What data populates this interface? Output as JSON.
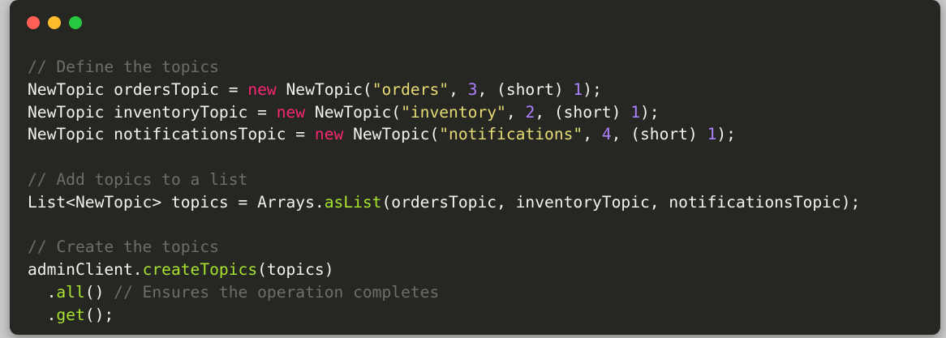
{
  "window": {
    "controls": [
      {
        "name": "close",
        "color": "#ff5f57"
      },
      {
        "name": "minimize",
        "color": "#febc2e"
      },
      {
        "name": "zoom",
        "color": "#28c840"
      }
    ]
  },
  "colors": {
    "background": "#262723",
    "text": "#f2f2ef",
    "comment": "#6e6e68",
    "keyword": "#f92672",
    "string": "#e6db74",
    "number": "#ae81ff",
    "function": "#a6e22e"
  },
  "code": {
    "lines": [
      [
        {
          "t": "cm",
          "v": "// Define the topics"
        }
      ],
      [
        {
          "t": "pl",
          "v": "NewTopic ordersTopic = "
        },
        {
          "t": "kw",
          "v": "new"
        },
        {
          "t": "pl",
          "v": " NewTopic("
        },
        {
          "t": "st",
          "v": "\"orders\""
        },
        {
          "t": "pl",
          "v": ", "
        },
        {
          "t": "nm",
          "v": "3"
        },
        {
          "t": "pl",
          "v": ", (short) "
        },
        {
          "t": "nm",
          "v": "1"
        },
        {
          "t": "pl",
          "v": ");"
        }
      ],
      [
        {
          "t": "pl",
          "v": "NewTopic inventoryTopic = "
        },
        {
          "t": "kw",
          "v": "new"
        },
        {
          "t": "pl",
          "v": " NewTopic("
        },
        {
          "t": "st",
          "v": "\"inventory\""
        },
        {
          "t": "pl",
          "v": ", "
        },
        {
          "t": "nm",
          "v": "2"
        },
        {
          "t": "pl",
          "v": ", (short) "
        },
        {
          "t": "nm",
          "v": "1"
        },
        {
          "t": "pl",
          "v": ");"
        }
      ],
      [
        {
          "t": "pl",
          "v": "NewTopic notificationsTopic = "
        },
        {
          "t": "kw",
          "v": "new"
        },
        {
          "t": "pl",
          "v": " NewTopic("
        },
        {
          "t": "st",
          "v": "\"notifications\""
        },
        {
          "t": "pl",
          "v": ", "
        },
        {
          "t": "nm",
          "v": "4"
        },
        {
          "t": "pl",
          "v": ", (short) "
        },
        {
          "t": "nm",
          "v": "1"
        },
        {
          "t": "pl",
          "v": ");"
        }
      ],
      [],
      [
        {
          "t": "cm",
          "v": "// Add topics to a list"
        }
      ],
      [
        {
          "t": "pl",
          "v": "List<NewTopic> topics = Arrays."
        },
        {
          "t": "fn",
          "v": "asList"
        },
        {
          "t": "pl",
          "v": "(ordersTopic, inventoryTopic, notificationsTopic);"
        }
      ],
      [],
      [
        {
          "t": "cm",
          "v": "// Create the topics"
        }
      ],
      [
        {
          "t": "pl",
          "v": "adminClient."
        },
        {
          "t": "fn",
          "v": "createTopics"
        },
        {
          "t": "pl",
          "v": "(topics)"
        }
      ],
      [
        {
          "t": "pl",
          "v": "  ."
        },
        {
          "t": "fn",
          "v": "all"
        },
        {
          "t": "pl",
          "v": "() "
        },
        {
          "t": "cm",
          "v": "// Ensures the operation completes"
        }
      ],
      [
        {
          "t": "pl",
          "v": "  ."
        },
        {
          "t": "fn",
          "v": "get"
        },
        {
          "t": "pl",
          "v": "();"
        }
      ]
    ]
  }
}
